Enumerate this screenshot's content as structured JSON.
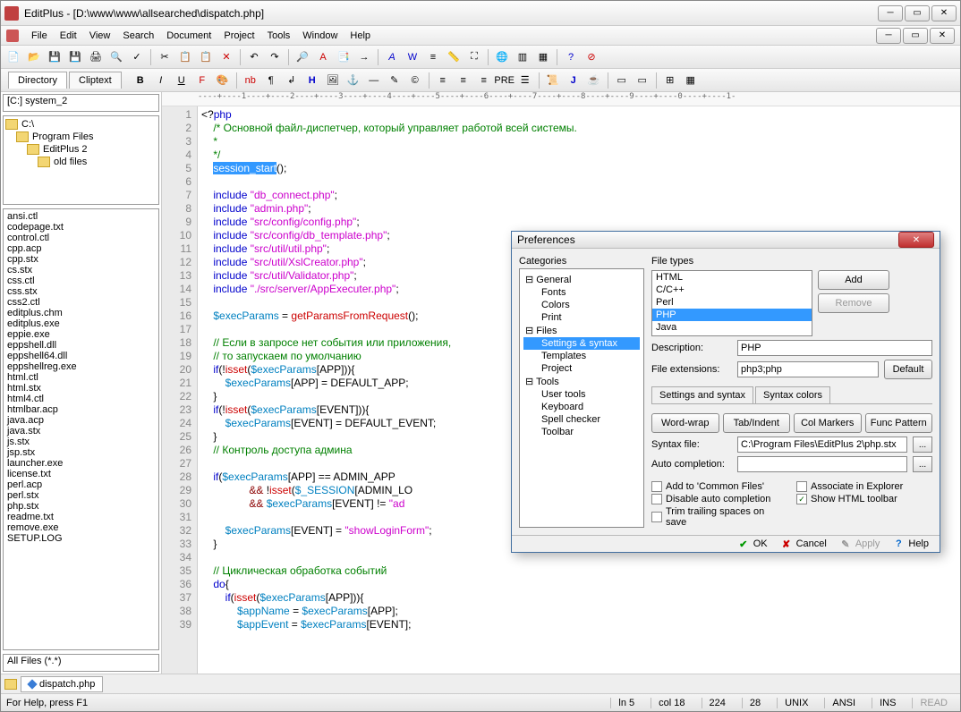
{
  "title": "EditPlus - [D:\\www\\www\\allsearched\\dispatch.php]",
  "menu": [
    "File",
    "Edit",
    "View",
    "Search",
    "Document",
    "Project",
    "Tools",
    "Window",
    "Help"
  ],
  "sidetabs": [
    "Directory",
    "Cliptext"
  ],
  "drive": "[C:] system_2",
  "folders": [
    {
      "label": "C:\\",
      "indent": 0
    },
    {
      "label": "Program Files",
      "indent": 1
    },
    {
      "label": "EditPlus 2",
      "indent": 2
    },
    {
      "label": "old files",
      "indent": 3
    }
  ],
  "files": [
    "ansi.ctl",
    "codepage.txt",
    "control.ctl",
    "cpp.acp",
    "cpp.stx",
    "cs.stx",
    "css.ctl",
    "css.stx",
    "css2.ctl",
    "editplus.chm",
    "editplus.exe",
    "eppie.exe",
    "eppshell.dll",
    "eppshell64.dll",
    "eppshellreg.exe",
    "html.ctl",
    "html.stx",
    "html4.ctl",
    "htmlbar.acp",
    "java.acp",
    "java.stx",
    "js.stx",
    "jsp.stx",
    "launcher.exe",
    "license.txt",
    "perl.acp",
    "perl.stx",
    "php.stx",
    "readme.txt",
    "remove.exe",
    "SETUP.LOG"
  ],
  "filter": "All Files (*.*)",
  "ruler": "----+----1----+----2----+----3----+----4----+----5----+----6----+----7----+----8----+----9----+----0----+----1-",
  "code_lines": [
    {
      "n": 1,
      "html": "&lt;?<span class='kw'>php</span>"
    },
    {
      "n": 2,
      "html": "    <span class='cm'>/* Основной файл-диспетчер, который управляет работой всей системы.</span>"
    },
    {
      "n": 3,
      "html": "    <span class='cm'>*</span>"
    },
    {
      "n": 4,
      "html": "    <span class='cm'>*/</span>"
    },
    {
      "n": 5,
      "html": "    <span class='sel'>session_start</span>();"
    },
    {
      "n": 6,
      "html": ""
    },
    {
      "n": 7,
      "html": "    <span class='kw'>include</span> <span class='str'>\"db_connect.php\"</span>;"
    },
    {
      "n": 8,
      "html": "    <span class='kw'>include</span> <span class='str'>\"admin.php\"</span>;"
    },
    {
      "n": 9,
      "html": "    <span class='kw'>include</span> <span class='str'>\"src/config/config.php\"</span>;"
    },
    {
      "n": 10,
      "html": "    <span class='kw'>include</span> <span class='str'>\"src/config/db_template.php\"</span>;"
    },
    {
      "n": 11,
      "html": "    <span class='kw'>include</span> <span class='str'>\"src/util/util.php\"</span>;"
    },
    {
      "n": 12,
      "html": "    <span class='kw'>include</span> <span class='str'>\"src/util/XslCreator.php\"</span>;"
    },
    {
      "n": 13,
      "html": "    <span class='kw'>include</span> <span class='str'>\"src/util/Validator.php\"</span>;"
    },
    {
      "n": 14,
      "html": "    <span class='kw'>include</span> <span class='str'>\"./src/server/AppExecuter.php\"</span>;"
    },
    {
      "n": 15,
      "html": ""
    },
    {
      "n": 16,
      "html": "    <span class='var'>$execParams</span> = <span class='fn'>getParamsFromRequest</span>();"
    },
    {
      "n": 17,
      "html": ""
    },
    {
      "n": 18,
      "html": "    <span class='cm'>// Если в запросе нет события или приложения,</span>"
    },
    {
      "n": 19,
      "html": "    <span class='cm'>// то запускаем по умолчанию</span>"
    },
    {
      "n": 20,
      "html": "    <span class='kw'>if</span>(!<span class='fn'>isset</span>(<span class='var'>$execParams</span>[APP])){"
    },
    {
      "n": 21,
      "html": "        <span class='var'>$execParams</span>[APP] = DEFAULT_APP;"
    },
    {
      "n": 22,
      "html": "    }"
    },
    {
      "n": 23,
      "html": "    <span class='kw'>if</span>(!<span class='fn'>isset</span>(<span class='var'>$execParams</span>[EVENT])){"
    },
    {
      "n": 24,
      "html": "        <span class='var'>$execParams</span>[EVENT] = DEFAULT_EVENT;"
    },
    {
      "n": 25,
      "html": "    }"
    },
    {
      "n": 26,
      "html": "    <span class='cm'>// Контроль доступа админа</span>"
    },
    {
      "n": 27,
      "html": ""
    },
    {
      "n": 28,
      "html": "    <span class='kw'>if</span>(<span class='var'>$execParams</span>[APP] == ADMIN_APP"
    },
    {
      "n": 29,
      "html": "                <span class='op'>&&</span> !<span class='fn'>isset</span>(<span class='var'>$_SESSION</span>[ADMIN_LO"
    },
    {
      "n": 30,
      "html": "                <span class='op'>&&</span> <span class='var'>$execParams</span>[EVENT] != <span class='str'>\"ad</span>"
    },
    {
      "n": 31,
      "html": ""
    },
    {
      "n": 32,
      "html": "        <span class='var'>$execParams</span>[EVENT] = <span class='str'>\"showLoginForm\"</span>;"
    },
    {
      "n": 33,
      "html": "    }"
    },
    {
      "n": 34,
      "html": ""
    },
    {
      "n": 35,
      "html": "    <span class='cm'>// Циклическая обработка событий</span>"
    },
    {
      "n": 36,
      "html": "    <span class='kw'>do</span>{"
    },
    {
      "n": 37,
      "html": "        <span class='kw'>if</span>(<span class='fn'>isset</span>(<span class='var'>$execParams</span>[APP])){"
    },
    {
      "n": 38,
      "html": "            <span class='var'>$appName</span> = <span class='var'>$execParams</span>[APP];"
    },
    {
      "n": 39,
      "html": "            <span class='var'>$appEvent</span> = <span class='var'>$execParams</span>[EVENT];"
    }
  ],
  "doctab": "dispatch.php",
  "status": {
    "help": "For Help, press F1",
    "ln": "ln 5",
    "col": "col 18",
    "s1": "224",
    "s2": "28",
    "os": "UNIX",
    "enc": "ANSI",
    "ins": "INS",
    "read": "READ"
  },
  "prefs": {
    "title": "Preferences",
    "cat_label": "Categories",
    "categories": [
      {
        "label": "General",
        "children": [
          "Fonts",
          "Colors",
          "Print"
        ]
      },
      {
        "label": "Files",
        "children": [
          "Settings & syntax",
          "Templates",
          "Project"
        ]
      },
      {
        "label": "Tools",
        "children": [
          "User tools",
          "Keyboard",
          "Spell checker",
          "Toolbar"
        ]
      }
    ],
    "selected_category": "Settings & syntax",
    "filetypes_label": "File types",
    "filetypes": [
      "HTML",
      "C/C++",
      "Perl",
      "PHP",
      "Java"
    ],
    "selected_filetype": "PHP",
    "add": "Add",
    "remove": "Remove",
    "desc_label": "Description:",
    "desc": "PHP",
    "ext_label": "File extensions:",
    "ext": "php3;php",
    "default": "Default",
    "tabs": [
      "Settings and syntax",
      "Syntax colors"
    ],
    "buttons": [
      "Word-wrap",
      "Tab/Indent",
      "Col Markers",
      "Func Pattern"
    ],
    "syntax_label": "Syntax file:",
    "syntax": "C:\\Program Files\\EditPlus 2\\php.stx",
    "auto_label": "Auto completion:",
    "auto": "",
    "checks": [
      {
        "label": "Add to 'Common Files'",
        "checked": false
      },
      {
        "label": "Associate in Explorer",
        "checked": false
      },
      {
        "label": "Disable auto completion",
        "checked": false
      },
      {
        "label": "Show HTML toolbar",
        "checked": true
      },
      {
        "label": "Trim trailing spaces on save",
        "checked": false
      }
    ],
    "footer": {
      "ok": "OK",
      "cancel": "Cancel",
      "apply": "Apply",
      "help": "Help"
    }
  }
}
